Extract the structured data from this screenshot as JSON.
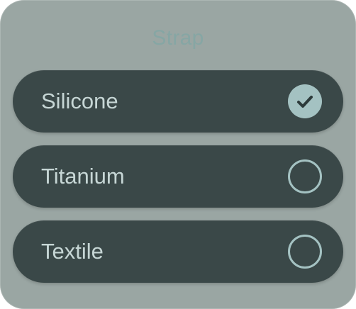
{
  "picker": {
    "title": "Strap",
    "options": [
      {
        "label": "Silicone",
        "selected": true
      },
      {
        "label": "Titanium",
        "selected": false
      },
      {
        "label": "Textile",
        "selected": false
      }
    ]
  },
  "colors": {
    "panel": "#9aa6a3",
    "option_background": "#3a4848",
    "accent": "#a4c2c2",
    "title_text": "#86a6a4",
    "option_text": "#c6d6d5"
  },
  "icons": {
    "selected": "checkmark-circle-icon",
    "unselected": "empty-circle-icon"
  }
}
